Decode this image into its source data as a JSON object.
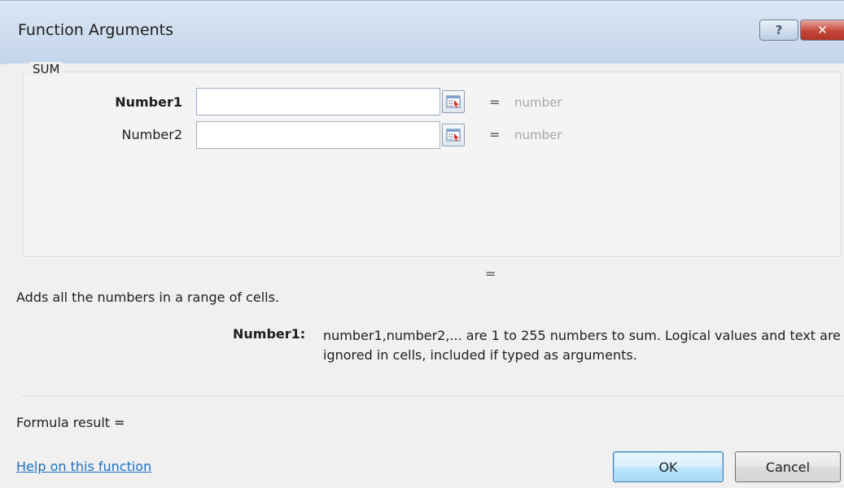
{
  "window": {
    "title": "Function Arguments",
    "help_glyph": "?",
    "close_glyph": "✕"
  },
  "function": {
    "name": "SUM",
    "args": [
      {
        "label": "Number1",
        "value": "",
        "preview_eq": "=",
        "preview": "number"
      },
      {
        "label": "Number2",
        "value": "",
        "preview_eq": "=",
        "preview": "number"
      }
    ],
    "result_eq": "=",
    "description": "Adds all the numbers in a range of cells.",
    "arg_help_name": "Number1:",
    "arg_help_text": "number1,number2,... are 1 to 255 numbers to sum. Logical values and text are ignored in cells, included if typed as arguments."
  },
  "footer": {
    "formula_result_label": "Formula result =",
    "help_link": "Help on this function",
    "ok_label": "OK",
    "cancel_label": "Cancel"
  },
  "icons": {
    "collapse": "collapse-dialog-icon"
  },
  "colors": {
    "titlebar": "#c4d5ea",
    "close": "#c6463a",
    "link": "#1f6fbf",
    "ok_border": "#3c7fb1"
  }
}
